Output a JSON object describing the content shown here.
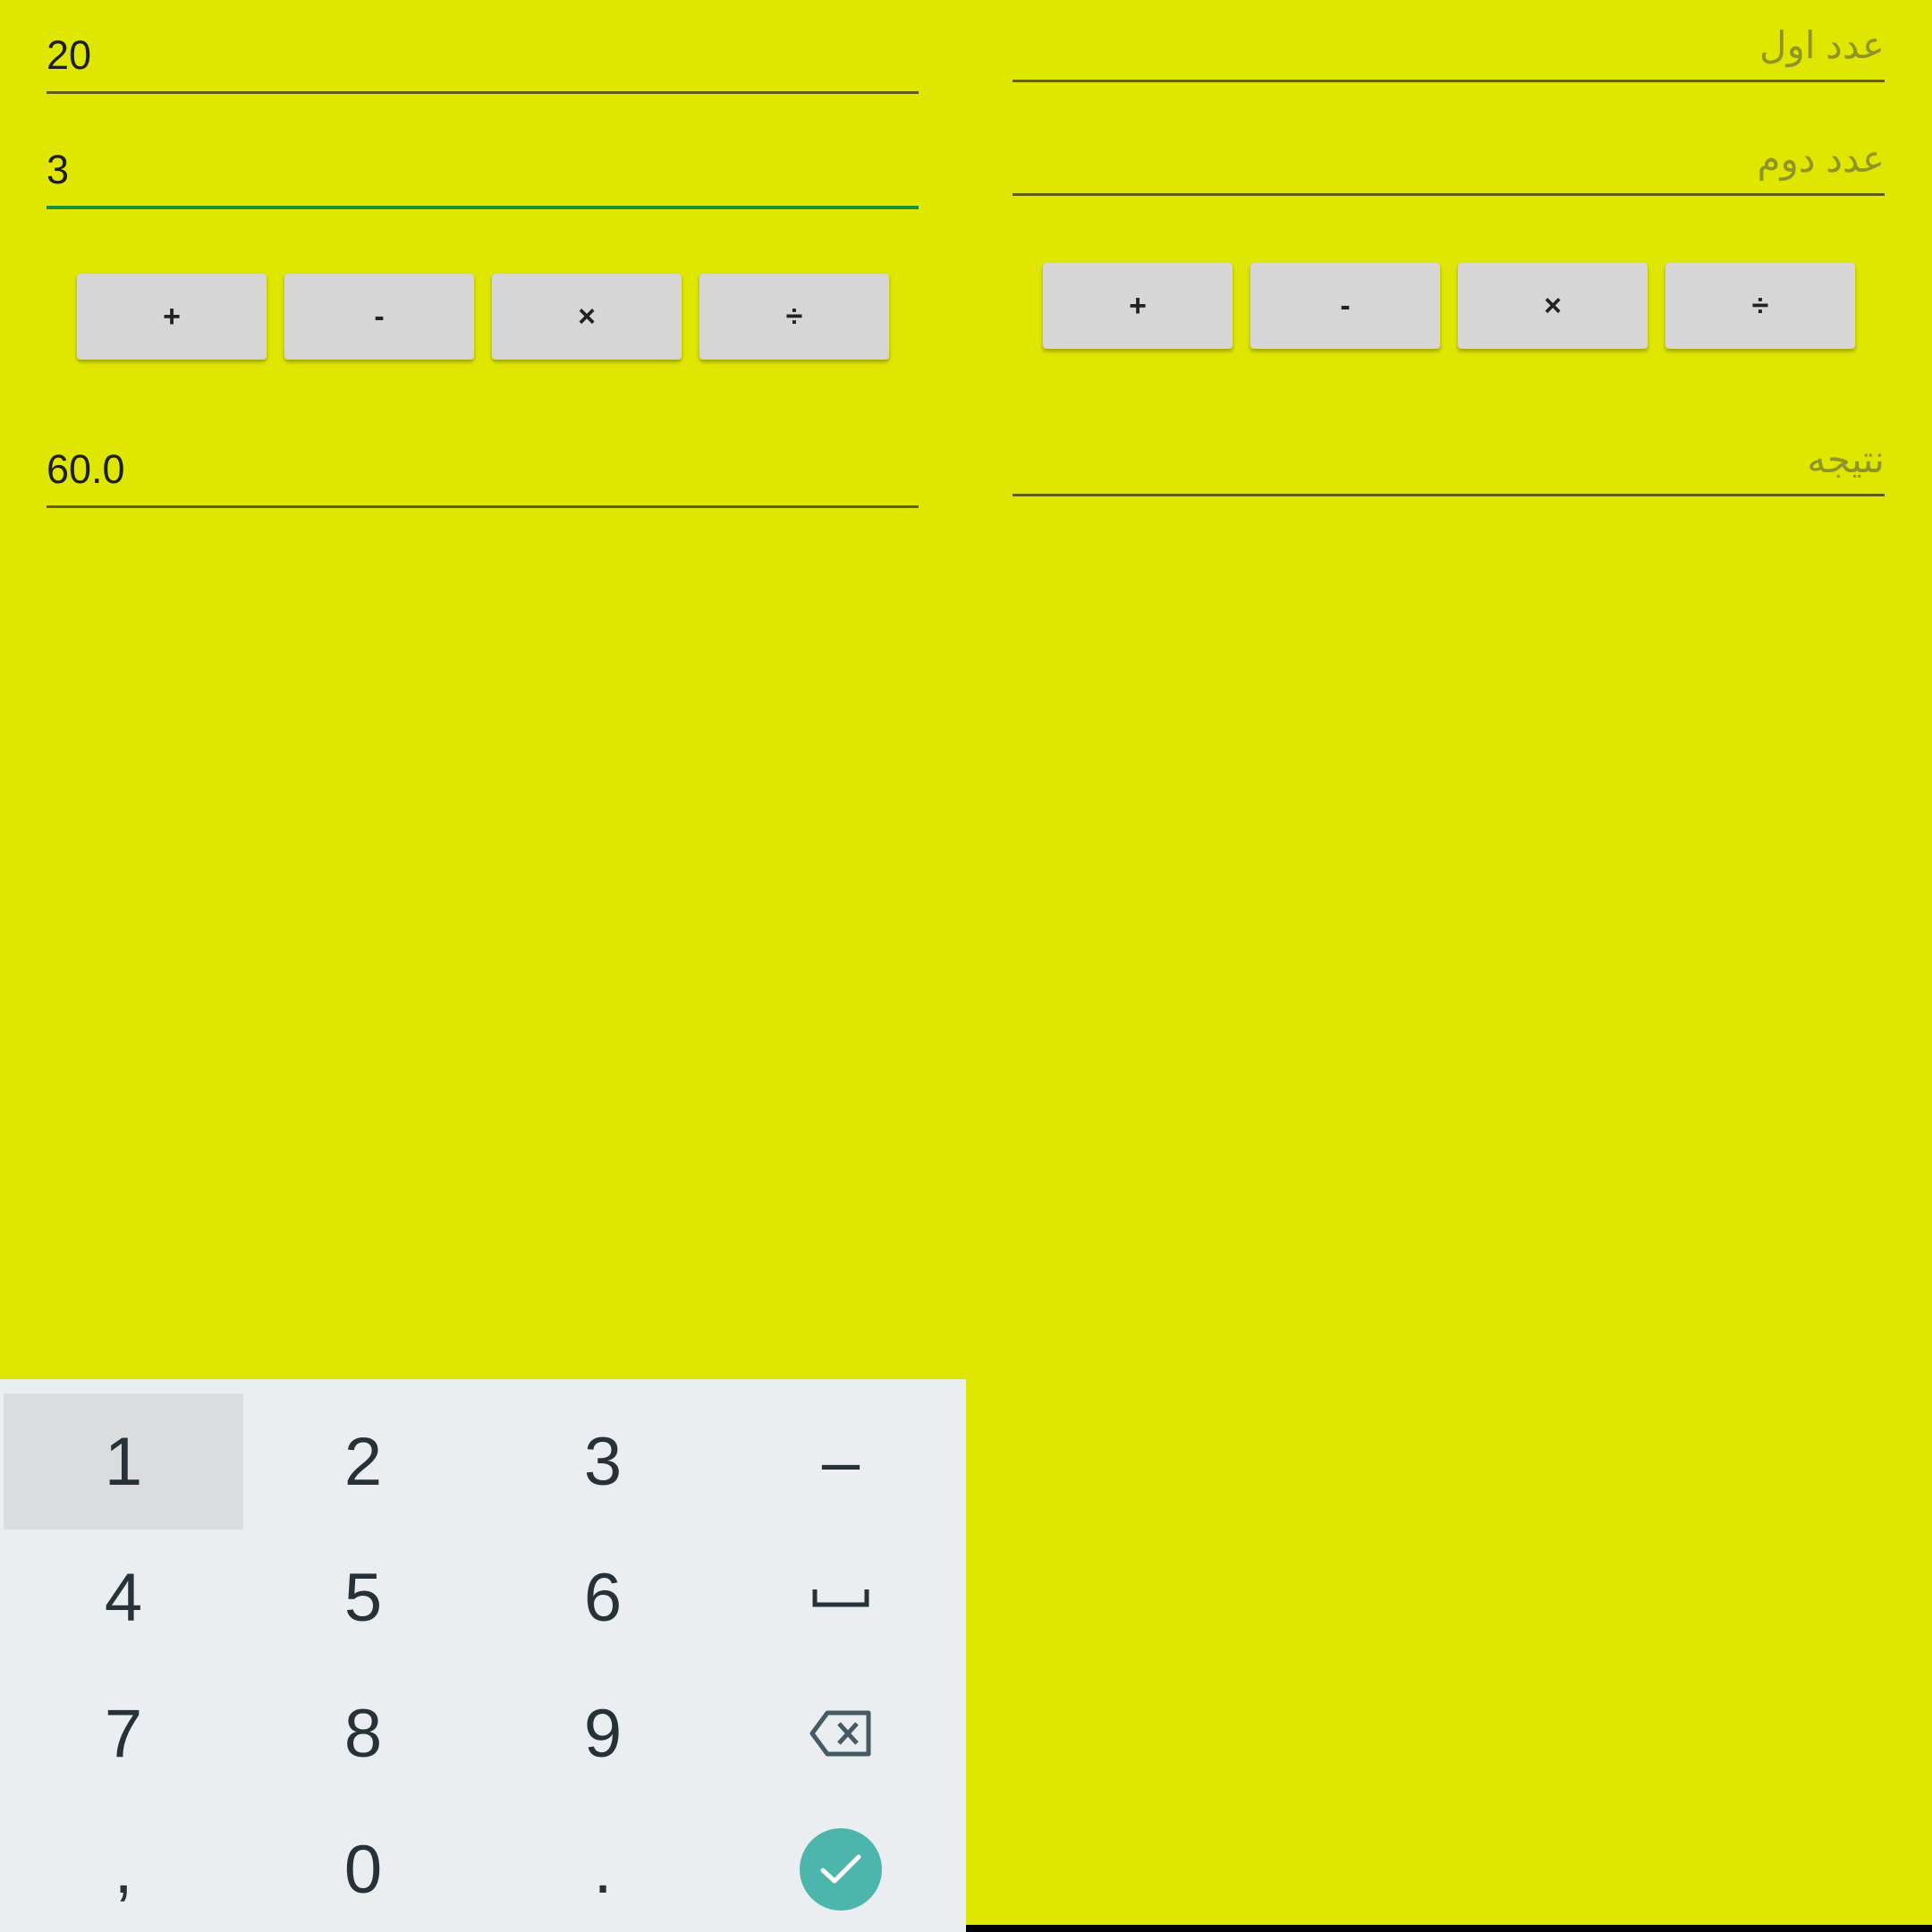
{
  "colors": {
    "background": "#dfe600",
    "focus_underline": "#1b8f3c",
    "keyboard_bg": "#ebeef0",
    "done_accent": "#4db6ac"
  },
  "left_screen": {
    "first_number": {
      "value": "20"
    },
    "second_number": {
      "value": "3",
      "focused": true
    },
    "operators": [
      "+",
      "-",
      "×",
      "÷"
    ],
    "result": {
      "value": "60.0"
    }
  },
  "right_screen": {
    "first_number": {
      "placeholder": "عدد اول"
    },
    "second_number": {
      "placeholder": "عدد دوم"
    },
    "operators": [
      "+",
      "-",
      "×",
      "÷"
    ],
    "result": {
      "placeholder": "نتیجه"
    }
  },
  "keyboard": {
    "rows": [
      [
        "1",
        "2",
        "3",
        "–"
      ],
      [
        "4",
        "5",
        "6",
        "space-icon"
      ],
      [
        "7",
        "8",
        "9",
        "backspace-icon"
      ],
      [
        ",",
        "0",
        ".",
        "done-check-icon"
      ]
    ],
    "pressed_key": "1"
  }
}
